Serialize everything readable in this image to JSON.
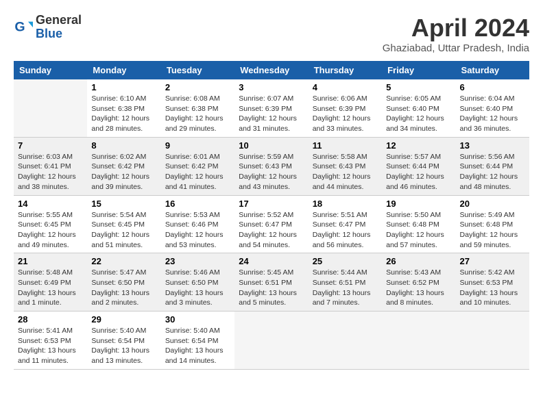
{
  "header": {
    "logo_general": "General",
    "logo_blue": "Blue",
    "month": "April 2024",
    "location": "Ghaziabad, Uttar Pradesh, India"
  },
  "columns": [
    "Sunday",
    "Monday",
    "Tuesday",
    "Wednesday",
    "Thursday",
    "Friday",
    "Saturday"
  ],
  "weeks": [
    [
      {
        "day": "",
        "info": ""
      },
      {
        "day": "1",
        "info": "Sunrise: 6:10 AM\nSunset: 6:38 PM\nDaylight: 12 hours\nand 28 minutes."
      },
      {
        "day": "2",
        "info": "Sunrise: 6:08 AM\nSunset: 6:38 PM\nDaylight: 12 hours\nand 29 minutes."
      },
      {
        "day": "3",
        "info": "Sunrise: 6:07 AM\nSunset: 6:39 PM\nDaylight: 12 hours\nand 31 minutes."
      },
      {
        "day": "4",
        "info": "Sunrise: 6:06 AM\nSunset: 6:39 PM\nDaylight: 12 hours\nand 33 minutes."
      },
      {
        "day": "5",
        "info": "Sunrise: 6:05 AM\nSunset: 6:40 PM\nDaylight: 12 hours\nand 34 minutes."
      },
      {
        "day": "6",
        "info": "Sunrise: 6:04 AM\nSunset: 6:40 PM\nDaylight: 12 hours\nand 36 minutes."
      }
    ],
    [
      {
        "day": "7",
        "info": "Sunrise: 6:03 AM\nSunset: 6:41 PM\nDaylight: 12 hours\nand 38 minutes."
      },
      {
        "day": "8",
        "info": "Sunrise: 6:02 AM\nSunset: 6:42 PM\nDaylight: 12 hours\nand 39 minutes."
      },
      {
        "day": "9",
        "info": "Sunrise: 6:01 AM\nSunset: 6:42 PM\nDaylight: 12 hours\nand 41 minutes."
      },
      {
        "day": "10",
        "info": "Sunrise: 5:59 AM\nSunset: 6:43 PM\nDaylight: 12 hours\nand 43 minutes."
      },
      {
        "day": "11",
        "info": "Sunrise: 5:58 AM\nSunset: 6:43 PM\nDaylight: 12 hours\nand 44 minutes."
      },
      {
        "day": "12",
        "info": "Sunrise: 5:57 AM\nSunset: 6:44 PM\nDaylight: 12 hours\nand 46 minutes."
      },
      {
        "day": "13",
        "info": "Sunrise: 5:56 AM\nSunset: 6:44 PM\nDaylight: 12 hours\nand 48 minutes."
      }
    ],
    [
      {
        "day": "14",
        "info": "Sunrise: 5:55 AM\nSunset: 6:45 PM\nDaylight: 12 hours\nand 49 minutes."
      },
      {
        "day": "15",
        "info": "Sunrise: 5:54 AM\nSunset: 6:45 PM\nDaylight: 12 hours\nand 51 minutes."
      },
      {
        "day": "16",
        "info": "Sunrise: 5:53 AM\nSunset: 6:46 PM\nDaylight: 12 hours\nand 53 minutes."
      },
      {
        "day": "17",
        "info": "Sunrise: 5:52 AM\nSunset: 6:47 PM\nDaylight: 12 hours\nand 54 minutes."
      },
      {
        "day": "18",
        "info": "Sunrise: 5:51 AM\nSunset: 6:47 PM\nDaylight: 12 hours\nand 56 minutes."
      },
      {
        "day": "19",
        "info": "Sunrise: 5:50 AM\nSunset: 6:48 PM\nDaylight: 12 hours\nand 57 minutes."
      },
      {
        "day": "20",
        "info": "Sunrise: 5:49 AM\nSunset: 6:48 PM\nDaylight: 12 hours\nand 59 minutes."
      }
    ],
    [
      {
        "day": "21",
        "info": "Sunrise: 5:48 AM\nSunset: 6:49 PM\nDaylight: 13 hours\nand 1 minute."
      },
      {
        "day": "22",
        "info": "Sunrise: 5:47 AM\nSunset: 6:50 PM\nDaylight: 13 hours\nand 2 minutes."
      },
      {
        "day": "23",
        "info": "Sunrise: 5:46 AM\nSunset: 6:50 PM\nDaylight: 13 hours\nand 3 minutes."
      },
      {
        "day": "24",
        "info": "Sunrise: 5:45 AM\nSunset: 6:51 PM\nDaylight: 13 hours\nand 5 minutes."
      },
      {
        "day": "25",
        "info": "Sunrise: 5:44 AM\nSunset: 6:51 PM\nDaylight: 13 hours\nand 7 minutes."
      },
      {
        "day": "26",
        "info": "Sunrise: 5:43 AM\nSunset: 6:52 PM\nDaylight: 13 hours\nand 8 minutes."
      },
      {
        "day": "27",
        "info": "Sunrise: 5:42 AM\nSunset: 6:53 PM\nDaylight: 13 hours\nand 10 minutes."
      }
    ],
    [
      {
        "day": "28",
        "info": "Sunrise: 5:41 AM\nSunset: 6:53 PM\nDaylight: 13 hours\nand 11 minutes."
      },
      {
        "day": "29",
        "info": "Sunrise: 5:40 AM\nSunset: 6:54 PM\nDaylight: 13 hours\nand 13 minutes."
      },
      {
        "day": "30",
        "info": "Sunrise: 5:40 AM\nSunset: 6:54 PM\nDaylight: 13 hours\nand 14 minutes."
      },
      {
        "day": "",
        "info": ""
      },
      {
        "day": "",
        "info": ""
      },
      {
        "day": "",
        "info": ""
      },
      {
        "day": "",
        "info": ""
      }
    ]
  ]
}
